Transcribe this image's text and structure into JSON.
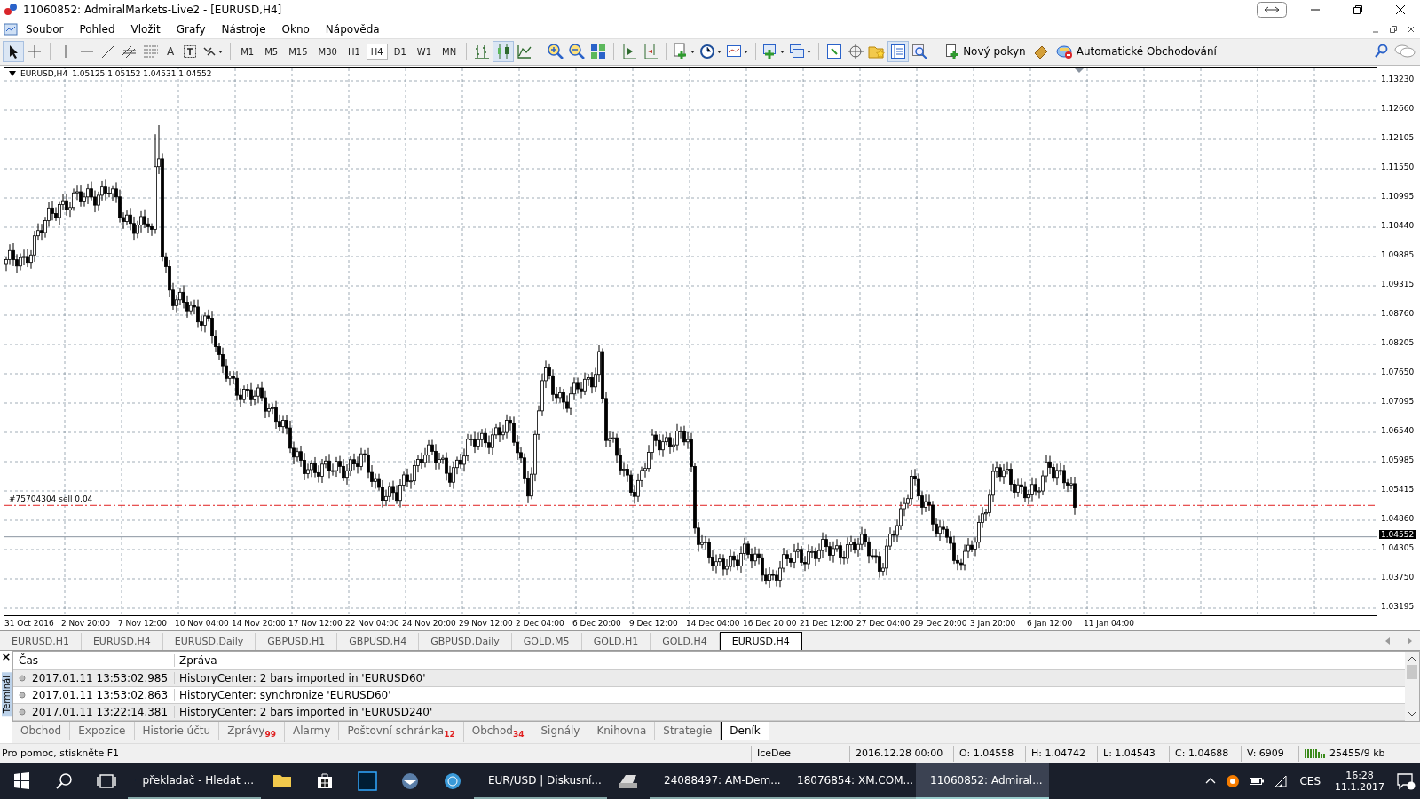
{
  "window": {
    "title": "11060852: AdmiralMarkets-Live2 - [EURUSD,H4]"
  },
  "menu": [
    {
      "label": "Soubor"
    },
    {
      "label": "Pohled"
    },
    {
      "label": "Vložit"
    },
    {
      "label": "Grafy"
    },
    {
      "label": "Nástroje"
    },
    {
      "label": "Okno"
    },
    {
      "label": "Nápověda"
    }
  ],
  "toolbar": {
    "text_tool": "A",
    "timeframes": [
      {
        "label": "M1",
        "selected": false
      },
      {
        "label": "M5",
        "selected": false
      },
      {
        "label": "M15",
        "selected": false
      },
      {
        "label": "M30",
        "selected": false
      },
      {
        "label": "H1",
        "selected": false
      },
      {
        "label": "H4",
        "selected": true
      },
      {
        "label": "D1",
        "selected": false
      },
      {
        "label": "W1",
        "selected": false
      },
      {
        "label": "MN",
        "selected": false
      }
    ],
    "new_order": "Nový pokyn",
    "auto_trading": "Automatické Obchodování"
  },
  "chart": {
    "symbol": "EURUSD,H4",
    "ohlc": "1.05125 1.05152 1.04531 1.04552",
    "price_labels": [
      "1.13230",
      "1.12660",
      "1.12105",
      "1.11550",
      "1.10995",
      "1.10440",
      "1.09885",
      "1.09315",
      "1.08760",
      "1.08205",
      "1.07650",
      "1.07095",
      "1.06540",
      "1.05985",
      "1.05415",
      "1.04860",
      "1.04305",
      "1.03750",
      "1.03195"
    ],
    "current_price": "1.04552",
    "order_label": "#75704304 sell 0.04",
    "time_labels": [
      "31 Oct 2016",
      "2 Nov 20:00",
      "7 Nov 12:00",
      "10 Nov 04:00",
      "14 Nov 20:00",
      "17 Nov 12:00",
      "22 Nov 04:00",
      "24 Nov 20:00",
      "29 Nov 12:00",
      "2 Dec 04:00",
      "6 Dec 20:00",
      "9 Dec 12:00",
      "14 Dec 04:00",
      "16 Dec 20:00",
      "21 Dec 12:00",
      "27 Dec 04:00",
      "29 Dec 20:00",
      "3 Jan 20:00",
      "6 Jan 12:00",
      "11 Jan 04:00"
    ]
  },
  "chart_tabs": [
    {
      "label": "EURUSD,H1",
      "selected": false
    },
    {
      "label": "EURUSD,H4",
      "selected": false
    },
    {
      "label": "EURUSD,Daily",
      "selected": false
    },
    {
      "label": "GBPUSD,H1",
      "selected": false
    },
    {
      "label": "GBPUSD,H4",
      "selected": false
    },
    {
      "label": "GBPUSD,Daily",
      "selected": false
    },
    {
      "label": "GOLD,M5",
      "selected": false
    },
    {
      "label": "GOLD,H1",
      "selected": false
    },
    {
      "label": "GOLD,H4",
      "selected": false
    },
    {
      "label": "EURUSD,H4",
      "selected": true
    }
  ],
  "terminal": {
    "side_label": "Terminál",
    "close": "×",
    "columns": [
      "Čas",
      "Zpráva"
    ],
    "rows": [
      {
        "time": "2017.01.11 13:53:02.985",
        "message": "HistoryCenter: 2 bars imported in 'EURUSD60'"
      },
      {
        "time": "2017.01.11 13:53:02.863",
        "message": "HistoryCenter: synchronize 'EURUSD60'"
      },
      {
        "time": "2017.01.11 13:22:14.381",
        "message": "HistoryCenter: 2 bars imported in 'EURUSD240'"
      }
    ],
    "tabs": [
      {
        "label": "Obchod",
        "selected": false
      },
      {
        "label": "Expozice",
        "selected": false
      },
      {
        "label": "Historie účtu",
        "selected": false
      },
      {
        "label": "Zprávy",
        "badge": "99",
        "selected": false
      },
      {
        "label": "Alarmy",
        "selected": false
      },
      {
        "label": "Poštovní schránka",
        "badge": "12",
        "selected": false
      },
      {
        "label": "Obchod",
        "badge": "34",
        "selected": false
      },
      {
        "label": "Signály",
        "selected": false
      },
      {
        "label": "Knihovna",
        "selected": false
      },
      {
        "label": "Strategie",
        "selected": false
      },
      {
        "label": "Deník",
        "selected": true
      }
    ]
  },
  "status_bar": {
    "help": "Pro pomoc, stiskněte F1",
    "profile": "IceDee",
    "date": "2016.12.28 00:00",
    "open": "O: 1.04558",
    "high": "H: 1.04742",
    "low": "L: 1.04543",
    "close": "C: 1.04688",
    "volume": "V: 6909",
    "traffic": "25455/9 kb"
  },
  "taskbar": {
    "items": [
      {
        "label": "překladač - Hledat ...",
        "active": false
      },
      {
        "label": "EUR/USD | Diskusní...",
        "active": false
      },
      {
        "label": "24088497: AM-Dem...",
        "active": false
      },
      {
        "label": "18076854: XM.COM...",
        "active": false
      },
      {
        "label": "11060852: Admiral...",
        "active": true
      }
    ],
    "language": "CES",
    "time": "16:28",
    "date": "11.1.2017"
  }
}
